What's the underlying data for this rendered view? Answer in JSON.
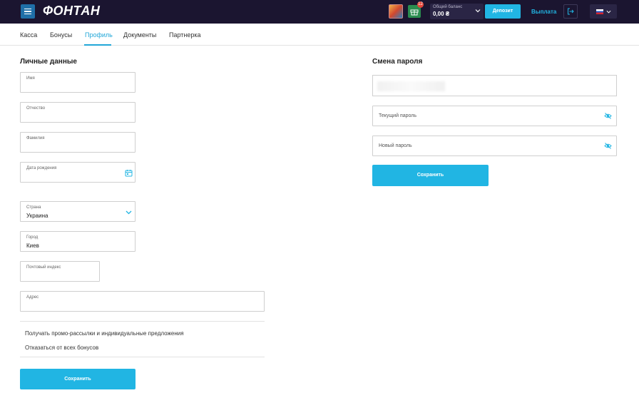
{
  "header": {
    "logo": "ФОНТАН",
    "gift_badge": "12",
    "balance_label": "Общий баланс",
    "balance_value": "0,00 ₴",
    "deposit_label": "Депозит",
    "withdraw_label": "Выплата",
    "colors": {
      "bg": "#1b1530",
      "accent": "#21b5e3"
    }
  },
  "tabs": [
    {
      "label": "Касса"
    },
    {
      "label": "Бонусы"
    },
    {
      "label": "Профиль",
      "active": true
    },
    {
      "label": "Документы"
    },
    {
      "label": "Партнерка"
    }
  ],
  "personal": {
    "title": "Личные данные",
    "first_name_label": "Имя",
    "middle_name_label": "Отчество",
    "last_name_label": "Фамилия",
    "birth_date_label": "Дата рождения",
    "country_label": "Страна",
    "country_value": "Украина",
    "city_label": "Город",
    "city_value": "Киев",
    "postal_label": "Почтовый индекс",
    "address_label": "Адрес",
    "promo_option": "Получать промо-рассылки и индивидуальные предложения",
    "refuse_bonus_option": "Отказаться от всех бонусов",
    "save_label": "Сохранить"
  },
  "password": {
    "title": "Смена пароля",
    "current_placeholder": "Текущий пароль",
    "new_placeholder": "Новый пароль",
    "save_label": "Сохранить"
  }
}
